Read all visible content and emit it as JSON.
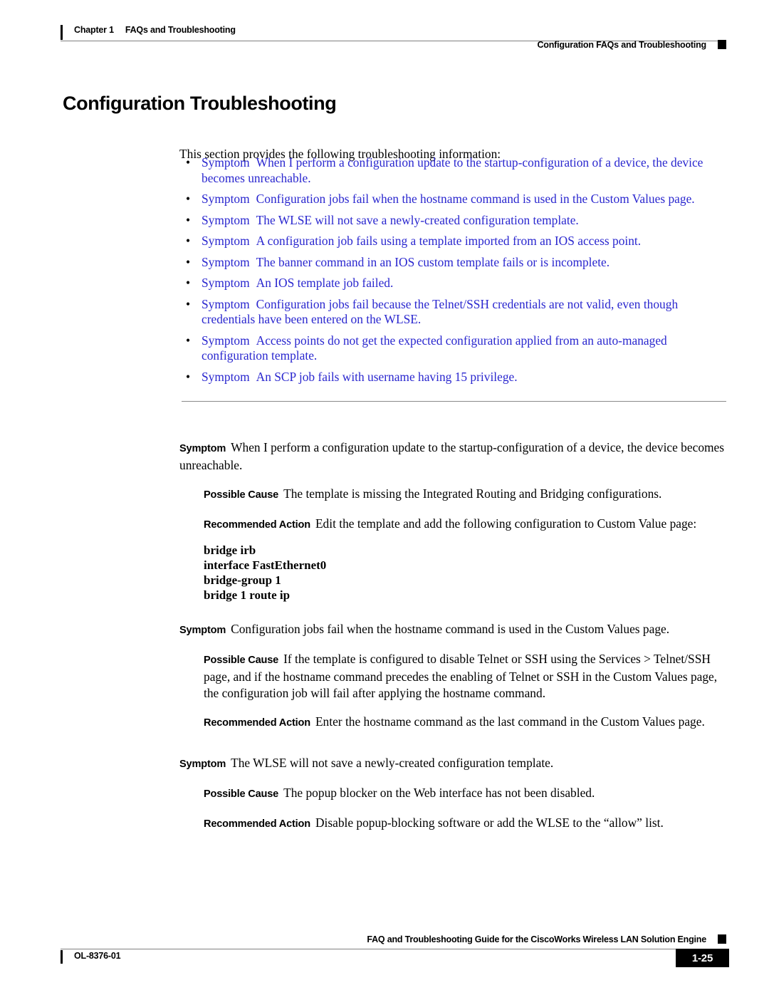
{
  "header": {
    "chapter": "Chapter 1",
    "chapter_title": "FAQs and Troubleshooting",
    "running_head_right": "Configuration FAQs and Troubleshooting"
  },
  "title": "Configuration Troubleshooting",
  "intro": "This section provides the following troubleshooting information:",
  "link_color": "#2a27cf",
  "symptom_links": [
    {
      "label": "Symptom",
      "text": "When I perform a configuration update to the startup-configuration of a device, the device becomes unreachable."
    },
    {
      "label": "Symptom",
      "text": "Configuration jobs fail when the hostname command is used in the Custom Values page."
    },
    {
      "label": "Symptom",
      "text": "The WLSE will not save a newly-created configuration template."
    },
    {
      "label": "Symptom",
      "text": "A configuration job fails using a template imported from an IOS access point."
    },
    {
      "label": "Symptom",
      "text": "The banner command in an IOS custom template fails or is incomplete."
    },
    {
      "label": "Symptom",
      "text": "An IOS template job failed."
    },
    {
      "label": "Symptom",
      "text": "Configuration jobs fail because the Telnet/SSH credentials are not valid, even though credentials have been entered on the WLSE."
    },
    {
      "label": "Symptom",
      "text": "Access points do not get the expected configuration applied from an auto-managed configuration template."
    },
    {
      "label": "Symptom",
      "text": "An SCP job fails with username having 15 privilege."
    }
  ],
  "sections": [
    {
      "symptom_label": "Symptom",
      "symptom_text": "When I perform a configuration update to the startup-configuration of a device, the device becomes unreachable.",
      "cause_label": "Possible Cause",
      "cause_text": "The template is missing the Integrated Routing and Bridging configurations.",
      "action_label": "Recommended Action",
      "action_text": "Edit the template and add the following configuration to Custom Value page:",
      "code_lines": [
        "bridge irb",
        "interface FastEthernet0",
        "bridge-group 1",
        "bridge 1 route ip"
      ]
    },
    {
      "symptom_label": "Symptom",
      "symptom_text": "Configuration jobs fail when the hostname command is used in the Custom Values page.",
      "cause_label": "Possible Cause",
      "cause_text": "If the template is configured to disable Telnet or SSH using the Services > Telnet/SSH page, and if the hostname command precedes the enabling of Telnet or SSH in the Custom Values page, the configuration job will fail after applying the hostname command.",
      "action_label": "Recommended Action",
      "action_text": "Enter the hostname command as the last command in the Custom Values page.",
      "code_lines": []
    },
    {
      "symptom_label": "Symptom",
      "symptom_text": "The WLSE will not save a newly-created configuration template.",
      "cause_label": "Possible Cause",
      "cause_text": "The popup blocker on the Web interface has not been disabled.",
      "action_label": "Recommended Action",
      "action_text": "Disable popup-blocking software or add the WLSE to the “allow” list.",
      "code_lines": []
    }
  ],
  "footer": {
    "doc_title": "FAQ and Troubleshooting Guide for the CiscoWorks Wireless LAN Solution Engine",
    "doc_id": "OL-8376-01",
    "page_number": "1-25"
  }
}
